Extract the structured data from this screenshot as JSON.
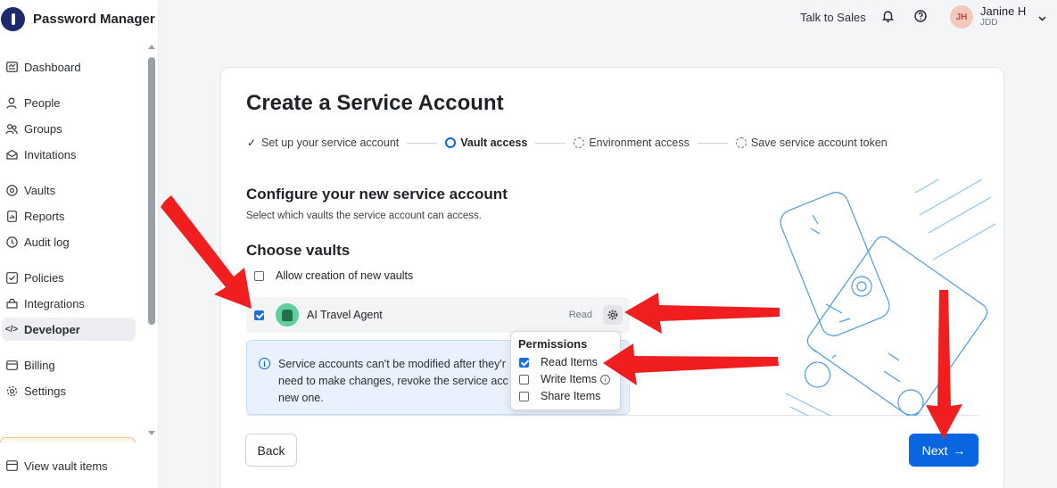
{
  "app": {
    "name": "Password Manager"
  },
  "sidebar": {
    "items": [
      {
        "label": "Dashboard",
        "icon": "dashboard-icon"
      },
      {
        "label": "People",
        "icon": "person-icon"
      },
      {
        "label": "Groups",
        "icon": "groups-icon"
      },
      {
        "label": "Invitations",
        "icon": "envelope-icon"
      },
      {
        "label": "Vaults",
        "icon": "vault-icon"
      },
      {
        "label": "Reports",
        "icon": "report-icon"
      },
      {
        "label": "Audit log",
        "icon": "clock-icon"
      },
      {
        "label": "Policies",
        "icon": "checklist-icon"
      },
      {
        "label": "Integrations",
        "icon": "integrations-icon"
      },
      {
        "label": "Developer",
        "icon": "code-icon",
        "active": true
      },
      {
        "label": "Billing",
        "icon": "card-icon"
      },
      {
        "label": "Settings",
        "icon": "gear-icon"
      }
    ],
    "footer_label": "View vault items"
  },
  "topbar": {
    "talk_to_sales": "Talk to Sales",
    "user_initials": "JH",
    "user_name": "Janine H",
    "user_org": "JDD"
  },
  "wizard": {
    "title": "Create a Service Account",
    "steps": [
      {
        "label": "Set up your service account",
        "state": "done"
      },
      {
        "label": "Vault access",
        "state": "current"
      },
      {
        "label": "Environment access",
        "state": "pending"
      },
      {
        "label": "Save service account token",
        "state": "pending"
      }
    ],
    "section_title": "Configure your new service account",
    "section_subtitle": "Select which vaults the service account can access.",
    "choose_title": "Choose vaults",
    "allow_new_vaults_label": "Allow creation of new vaults",
    "allow_new_vaults_checked": false,
    "vault": {
      "name": "AI Travel Agent",
      "permission": "Read",
      "checked": true
    },
    "info_lines": [
      "Service accounts can't be modified after they'r",
      "need to make changes, revoke the service acc",
      "new one."
    ],
    "permissions_popover": {
      "title": "Permissions",
      "options": [
        {
          "label": "Read Items",
          "checked": true
        },
        {
          "label": "Write Items",
          "checked": false
        },
        {
          "label": "Share Items",
          "checked": false
        }
      ]
    },
    "back_label": "Back",
    "next_label": "Next"
  },
  "colors": {
    "primary": "#0a66e0",
    "annotation_arrow": "#f01e1e",
    "vault_icon": "#5fcf9c"
  }
}
